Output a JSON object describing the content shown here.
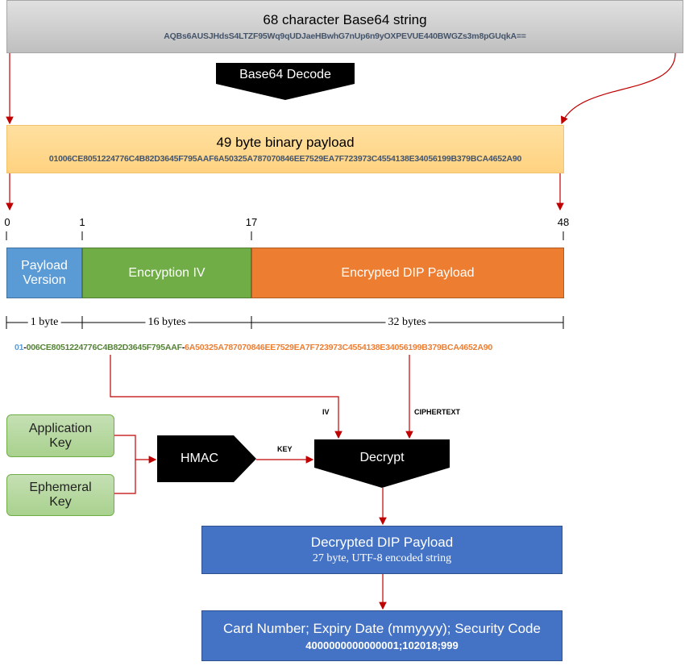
{
  "base64": {
    "title": "68 character Base64 string",
    "value": "AQBs6AUSJHdsS4LTZF95Wq9qUDJaeHBwhG7nUp6n9yOXPEVUE440BWGZs3m8pGUqkA=="
  },
  "decode_label": "Base64 Decode",
  "binary": {
    "title": "49 byte binary payload",
    "value": "01006CE8051224776C4B82D3645F795AAF6A50325A787070846EE7529EA7F723973C4554138E34056199B379BCA4652A90"
  },
  "offsets": [
    "0",
    "1",
    "17",
    "48"
  ],
  "segments": [
    {
      "label": "Payload Version",
      "size": "1 byte",
      "hex": "01",
      "color": "#5b9bd5"
    },
    {
      "label": "Encryption IV",
      "size": "16 bytes",
      "hex": "006CE8051224776C4B82D3645F795AAF",
      "color": "#70ad47"
    },
    {
      "label": "Encrypted DIP Payload",
      "size": "32 bytes",
      "hex": "6A50325A787070846EE7529EA7F723973C4554138E34056199B379BCA4652A90",
      "color": "#ed7d31"
    }
  ],
  "separator": "-",
  "labels": {
    "iv": "IV",
    "ciphertext": "CIPHERTEXT",
    "key": "KEY"
  },
  "keys": {
    "application": "Application Key",
    "ephemeral": "Ephemeral Key"
  },
  "hmac_label": "HMAC",
  "decrypt_label": "Decrypt",
  "decrypted": {
    "title": "Decrypted DIP Payload",
    "subtitle": "27 byte, UTF-8 encoded string"
  },
  "result": {
    "title": "Card Number; Expiry Date (mmyyyy); Security Code",
    "value": "4000000000000001;102018;999"
  }
}
